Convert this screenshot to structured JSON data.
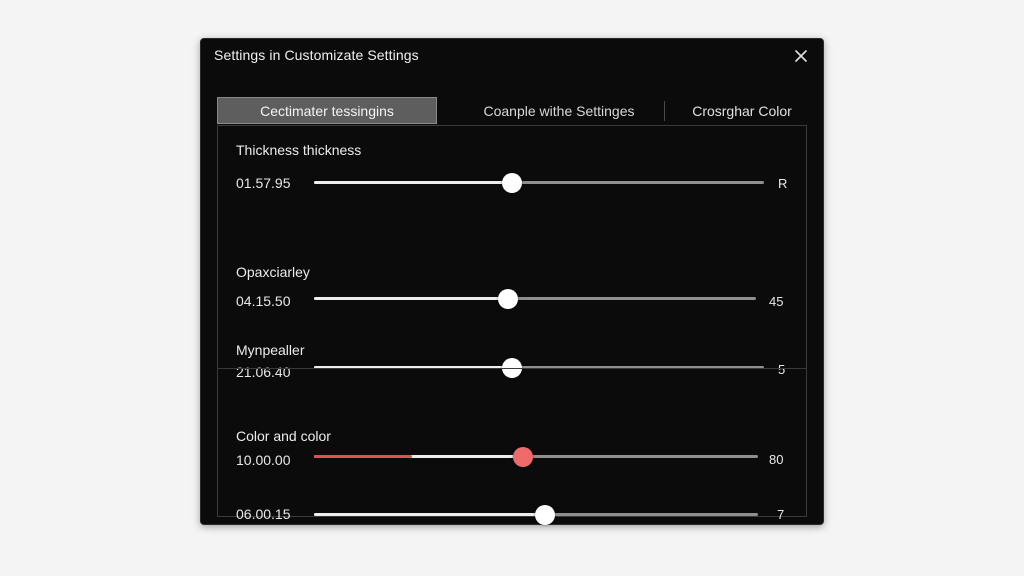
{
  "window": {
    "title": "Settings in Customizate Settings",
    "close_icon": "close-icon"
  },
  "tabs": [
    {
      "label": "Cectimater tessingins",
      "active": true
    },
    {
      "label": "Coanple withe Settinges",
      "active": false
    },
    {
      "label": "Crosrghar Color",
      "active": false
    }
  ],
  "sliders": [
    {
      "label": "Thickness thickness",
      "value": "01.57.95",
      "end_value": "R",
      "level": 0.44
    },
    {
      "label": "Opaxciarley",
      "value": "04.15.50",
      "end_value": "45",
      "level": 0.44
    },
    {
      "label": "Mynpealler",
      "value": "21.06.40",
      "end_value": "5",
      "level": 0.44
    },
    {
      "label": "Color and color",
      "value": "10.00.00",
      "end_value": "80",
      "level": 0.47,
      "accent_level": 0.22
    },
    {
      "label": "",
      "value": "06.00.15",
      "end_value": "7",
      "level": 0.52
    }
  ],
  "colors": {
    "accent": "#e05050",
    "thumb_accent": "#ef6a6a",
    "background": "#0b0b0b"
  }
}
